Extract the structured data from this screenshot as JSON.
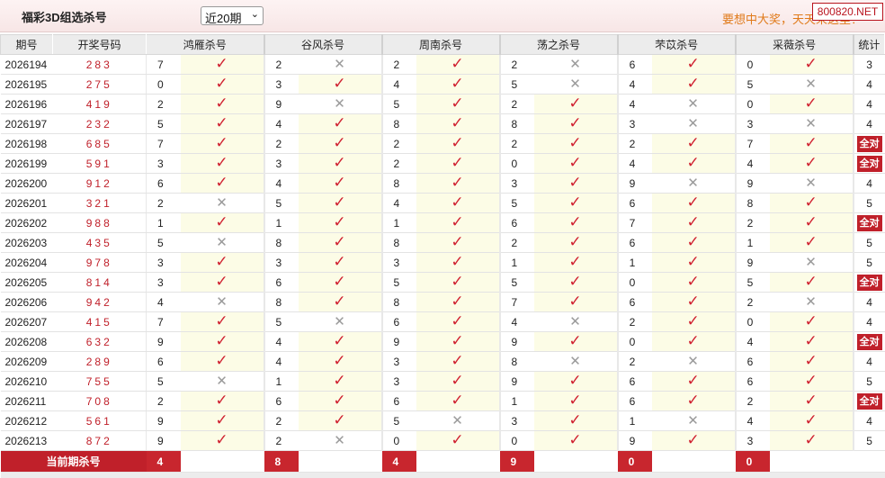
{
  "header": {
    "title": "福彩3D组选杀号",
    "period_select": "近20期",
    "marquee": "要想中大奖，天天来这里！",
    "site_badge": "800820.NET"
  },
  "table": {
    "columns": [
      "期号",
      "开奖号码",
      "鸿雁杀号",
      "谷风杀号",
      "周南杀号",
      "荡之杀号",
      "芣苡杀号",
      "采薇杀号",
      "统计"
    ],
    "all_right_label": "全对",
    "rows": [
      {
        "issue": "2026194",
        "draw": "283",
        "kills": [
          7,
          2,
          2,
          2,
          6,
          0
        ],
        "hits": [
          1,
          0,
          1,
          0,
          1,
          1
        ],
        "stat": "3"
      },
      {
        "issue": "2026195",
        "draw": "275",
        "kills": [
          0,
          3,
          4,
          5,
          4,
          5
        ],
        "hits": [
          1,
          1,
          1,
          0,
          1,
          0
        ],
        "stat": "4"
      },
      {
        "issue": "2026196",
        "draw": "419",
        "kills": [
          2,
          9,
          5,
          2,
          4,
          0
        ],
        "hits": [
          1,
          0,
          1,
          1,
          0,
          1
        ],
        "stat": "4"
      },
      {
        "issue": "2026197",
        "draw": "232",
        "kills": [
          5,
          4,
          8,
          8,
          3,
          3
        ],
        "hits": [
          1,
          1,
          1,
          1,
          0,
          0
        ],
        "stat": "4"
      },
      {
        "issue": "2026198",
        "draw": "685",
        "kills": [
          7,
          2,
          2,
          2,
          2,
          7
        ],
        "hits": [
          1,
          1,
          1,
          1,
          1,
          1
        ],
        "stat": "全对"
      },
      {
        "issue": "2026199",
        "draw": "591",
        "kills": [
          3,
          3,
          2,
          0,
          4,
          4
        ],
        "hits": [
          1,
          1,
          1,
          1,
          1,
          1
        ],
        "stat": "全对"
      },
      {
        "issue": "2026200",
        "draw": "912",
        "kills": [
          6,
          4,
          8,
          3,
          9,
          9
        ],
        "hits": [
          1,
          1,
          1,
          1,
          0,
          0
        ],
        "stat": "4"
      },
      {
        "issue": "2026201",
        "draw": "321",
        "kills": [
          2,
          5,
          4,
          5,
          6,
          8
        ],
        "hits": [
          0,
          1,
          1,
          1,
          1,
          1
        ],
        "stat": "5"
      },
      {
        "issue": "2026202",
        "draw": "988",
        "kills": [
          1,
          1,
          1,
          6,
          7,
          2
        ],
        "hits": [
          1,
          1,
          1,
          1,
          1,
          1
        ],
        "stat": "全对"
      },
      {
        "issue": "2026203",
        "draw": "435",
        "kills": [
          5,
          8,
          8,
          2,
          6,
          1
        ],
        "hits": [
          0,
          1,
          1,
          1,
          1,
          1
        ],
        "stat": "5"
      },
      {
        "issue": "2026204",
        "draw": "978",
        "kills": [
          3,
          3,
          3,
          1,
          1,
          9
        ],
        "hits": [
          1,
          1,
          1,
          1,
          1,
          0
        ],
        "stat": "5"
      },
      {
        "issue": "2026205",
        "draw": "814",
        "kills": [
          3,
          6,
          5,
          5,
          0,
          5
        ],
        "hits": [
          1,
          1,
          1,
          1,
          1,
          1
        ],
        "stat": "全对"
      },
      {
        "issue": "2026206",
        "draw": "942",
        "kills": [
          4,
          8,
          8,
          7,
          6,
          2
        ],
        "hits": [
          0,
          1,
          1,
          1,
          1,
          0
        ],
        "stat": "4"
      },
      {
        "issue": "2026207",
        "draw": "415",
        "kills": [
          7,
          5,
          6,
          4,
          2,
          0
        ],
        "hits": [
          1,
          0,
          1,
          0,
          1,
          1
        ],
        "stat": "4"
      },
      {
        "issue": "2026208",
        "draw": "632",
        "kills": [
          9,
          4,
          9,
          9,
          0,
          4
        ],
        "hits": [
          1,
          1,
          1,
          1,
          1,
          1
        ],
        "stat": "全对"
      },
      {
        "issue": "2026209",
        "draw": "289",
        "kills": [
          6,
          4,
          3,
          8,
          2,
          6
        ],
        "hits": [
          1,
          1,
          1,
          0,
          0,
          1
        ],
        "stat": "4"
      },
      {
        "issue": "2026210",
        "draw": "755",
        "kills": [
          5,
          1,
          3,
          9,
          6,
          6
        ],
        "hits": [
          0,
          1,
          1,
          1,
          1,
          1
        ],
        "stat": "5"
      },
      {
        "issue": "2026211",
        "draw": "708",
        "kills": [
          2,
          6,
          6,
          1,
          6,
          2
        ],
        "hits": [
          1,
          1,
          1,
          1,
          1,
          1
        ],
        "stat": "全对"
      },
      {
        "issue": "2026212",
        "draw": "561",
        "kills": [
          9,
          2,
          5,
          3,
          1,
          4
        ],
        "hits": [
          1,
          1,
          0,
          1,
          0,
          1
        ],
        "stat": "4"
      },
      {
        "issue": "2026213",
        "draw": "872",
        "kills": [
          9,
          2,
          0,
          0,
          9,
          3
        ],
        "hits": [
          1,
          0,
          1,
          1,
          1,
          1
        ],
        "stat": "5"
      }
    ],
    "current": {
      "label": "当前期杀号",
      "kills": [
        4,
        8,
        4,
        9,
        0,
        0
      ]
    }
  },
  "colors": {
    "accent_red": "#c0202a",
    "hit_red": "#d02030",
    "miss_gray": "#9a9a9a",
    "marquee_orange": "#e07a1a"
  },
  "icons": {
    "hit": "check-icon",
    "miss": "cross-icon"
  }
}
